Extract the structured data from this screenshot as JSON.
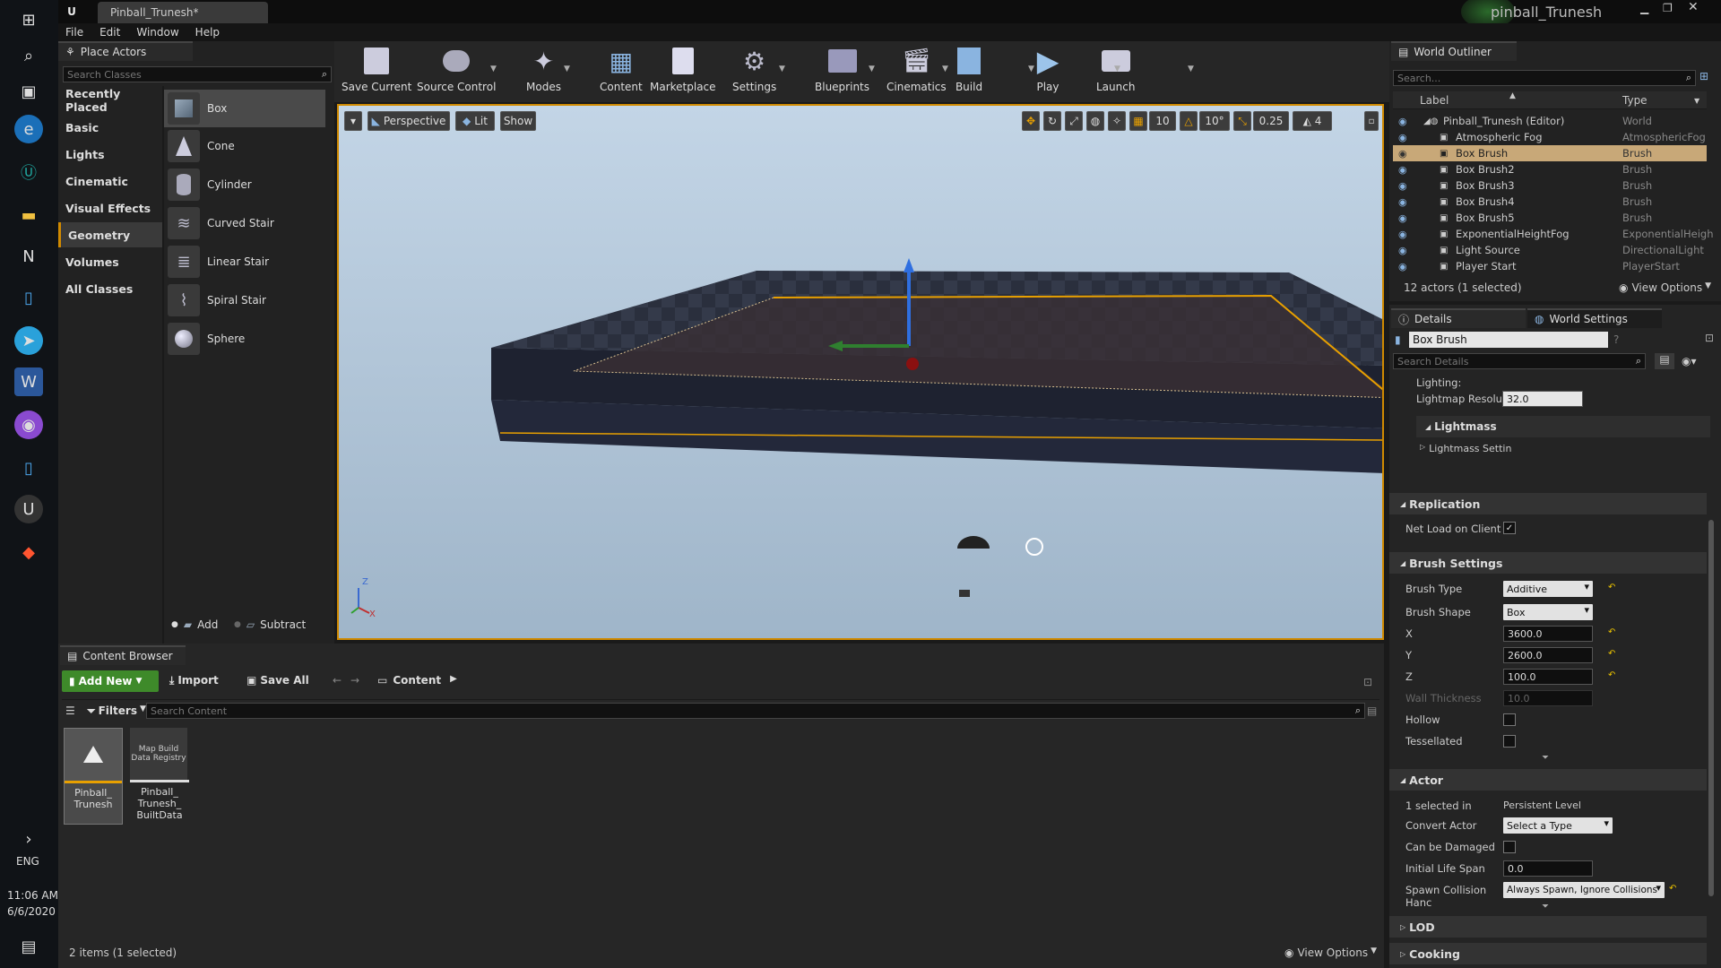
{
  "window": {
    "tab_title": "Pinball_Trunesh*",
    "project_name": "pinball_Trunesh"
  },
  "menu": [
    "File",
    "Edit",
    "Window",
    "Help"
  ],
  "system": {
    "language": "ENG",
    "time": "11:06 AM",
    "date": "6/6/2020"
  },
  "place_actors": {
    "tab": "Place Actors",
    "search_placeholder": "Search Classes",
    "categories": [
      "Recently Placed",
      "Basic",
      "Lights",
      "Cinematic",
      "Visual Effects",
      "Geometry",
      "Volumes",
      "All Classes"
    ],
    "selected_category": "Geometry",
    "items": [
      "Box",
      "Cone",
      "Cylinder",
      "Curved Stair",
      "Linear Stair",
      "Spiral Stair",
      "Sphere"
    ],
    "selected_item": "Box",
    "add_label": "Add",
    "subtract_label": "Subtract"
  },
  "toolbar": [
    "Save Current",
    "Source Control",
    "Modes",
    "Content",
    "Marketplace",
    "Settings",
    "Blueprints",
    "Cinematics",
    "Build",
    "Play",
    "Launch"
  ],
  "viewport": {
    "perspective": "Perspective",
    "lit": "Lit",
    "show": "Show",
    "grid_snap": "10",
    "rot_snap": "10°",
    "scale_snap": "0.25",
    "camera_speed": "4",
    "axis_z": "Z",
    "axis_x": "X"
  },
  "content_browser": {
    "tab": "Content Browser",
    "add_new": "Add New",
    "import": "Import",
    "save_all": "Save All",
    "path": "Content",
    "filters": "Filters",
    "search_placeholder": "Search Content",
    "assets": [
      {
        "label": "Pinball_ Trunesh",
        "thumb_text": ""
      },
      {
        "label": "Pinball_ Trunesh_ BuiltData",
        "thumb_text": "Map Build Data Registry"
      }
    ],
    "status": "2 items (1 selected)",
    "view_options": "View Options"
  },
  "outliner": {
    "tab": "World Outliner",
    "search_placeholder": "Search...",
    "col_label": "Label",
    "col_type": "Type",
    "rows": [
      {
        "label": "Pinball_Trunesh (Editor)",
        "type": "World"
      },
      {
        "label": "Atmospheric Fog",
        "type": "AtmosphericFog"
      },
      {
        "label": "Box Brush",
        "type": "Brush"
      },
      {
        "label": "Box Brush2",
        "type": "Brush"
      },
      {
        "label": "Box Brush3",
        "type": "Brush"
      },
      {
        "label": "Box Brush4",
        "type": "Brush"
      },
      {
        "label": "Box Brush5",
        "type": "Brush"
      },
      {
        "label": "ExponentialHeightFog",
        "type": "ExponentialHeigh"
      },
      {
        "label": "Light Source",
        "type": "DirectionalLight"
      },
      {
        "label": "Player Start",
        "type": "PlayerStart"
      }
    ],
    "selected_row": "Box Brush",
    "status": "12 actors (1 selected)",
    "view_options": "View Options"
  },
  "details": {
    "tab": "Details",
    "tab2": "World Settings",
    "name": "Box Brush",
    "search_placeholder": "Search Details",
    "lighting_label": "Lighting:",
    "lightmap_label": "Lightmap Resolution",
    "lightmap_value": "32.0",
    "lightmass": "Lightmass",
    "lightmass_settings": "Lightmass Settin",
    "replication": "Replication",
    "net_load": "Net Load on Client",
    "brush_settings": "Brush Settings",
    "brush_type_label": "Brush Type",
    "brush_type": "Additive",
    "brush_shape_label": "Brush Shape",
    "brush_shape": "Box",
    "x_label": "X",
    "x": "3600.0",
    "y_label": "Y",
    "y": "2600.0",
    "z_label": "Z",
    "z": "100.0",
    "wall_label": "Wall Thickness",
    "wall": "10.0",
    "hollow": "Hollow",
    "tessellated": "Tessellated",
    "actor": "Actor",
    "selected_in_label": "1 selected in",
    "selected_in": "Persistent Level",
    "convert_label": "Convert Actor",
    "convert": "Select a Type",
    "damaged_label": "Can be Damaged",
    "lifespan_label": "Initial Life Span",
    "lifespan": "0.0",
    "spawn_label": "Spawn Collision Hanc",
    "spawn": "Always Spawn, Ignore Collisions",
    "lod": "LOD",
    "cooking": "Cooking"
  }
}
